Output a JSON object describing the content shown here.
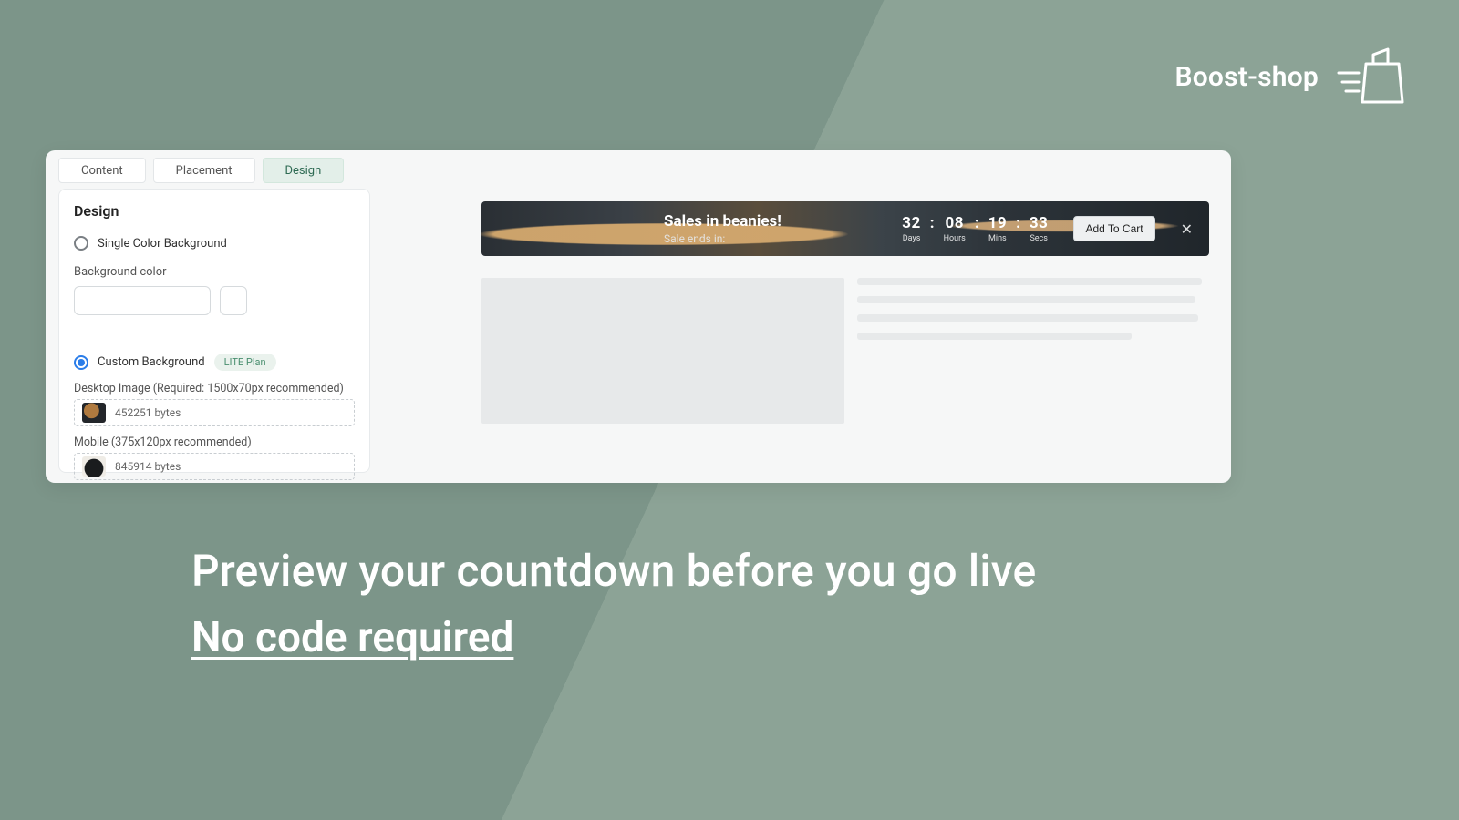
{
  "brand": {
    "name": "Boost-shop"
  },
  "tabs": [
    {
      "label": "Content",
      "active": false
    },
    {
      "label": "Placement",
      "active": false
    },
    {
      "label": "Design",
      "active": true
    }
  ],
  "design": {
    "heading": "Design",
    "single_color_label": "Single Color Background",
    "background_color_label": "Background color",
    "custom_bg_label": "Custom Background",
    "lite_plan_badge": "LITE Plan",
    "desktop_image_label": "Desktop Image (Required: 1500x70px recommended)",
    "desktop_image_bytes": "452251 bytes",
    "mobile_image_label": "Mobile (375x120px recommended)",
    "mobile_image_bytes": "845914 bytes",
    "selected_option": "custom"
  },
  "banner": {
    "title": "Sales in beanies!",
    "subtitle": "Sale ends in:",
    "countdown": {
      "days": "32",
      "hours": "08",
      "mins": "19",
      "secs": "33",
      "labels": {
        "days": "Days",
        "hours": "Hours",
        "mins": "Mins",
        "secs": "Secs"
      }
    },
    "cta": "Add To Cart"
  },
  "headline": {
    "line1": "Preview your countdown before you go live",
    "line2": "No code required"
  }
}
